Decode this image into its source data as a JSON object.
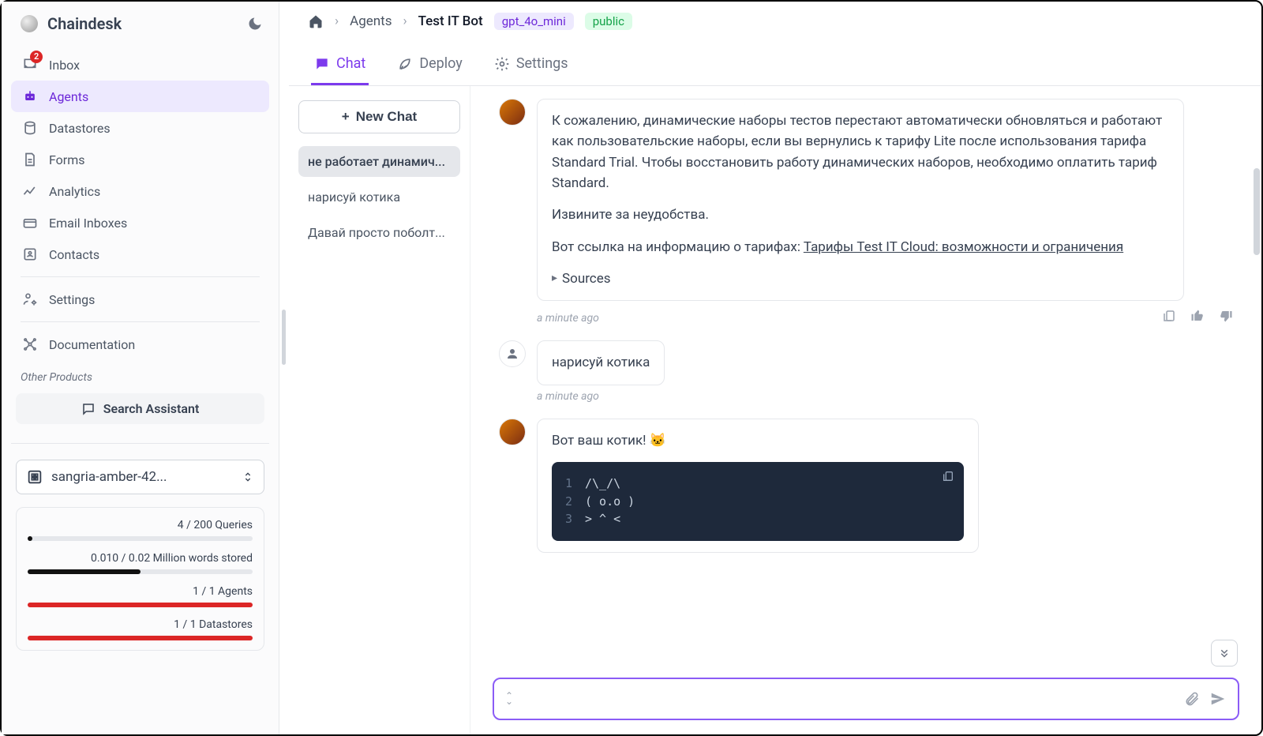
{
  "brand": {
    "name": "Chaindesk"
  },
  "sidebar": {
    "items": [
      {
        "label": "Inbox",
        "badge": "2"
      },
      {
        "label": "Agents"
      },
      {
        "label": "Datastores"
      },
      {
        "label": "Forms"
      },
      {
        "label": "Analytics"
      },
      {
        "label": "Email Inboxes"
      },
      {
        "label": "Contacts"
      }
    ],
    "settings_label": "Settings",
    "docs_label": "Documentation",
    "other_label": "Other Products",
    "search_assistant_label": "Search Assistant",
    "org_name": "sangria-amber-42..."
  },
  "usage": {
    "queries": "4 / 200 Queries",
    "words": "0.010 / 0.02 Million words stored",
    "agents": "1 / 1 Agents",
    "datastores": "1 / 1 Datastores"
  },
  "breadcrumb": {
    "agents": "Agents",
    "bot": "Test IT Bot",
    "model": "gpt_4o_mini",
    "status": "public"
  },
  "tabs": {
    "chat": "Chat",
    "deploy": "Deploy",
    "settings": "Settings"
  },
  "chatlist": {
    "new_chat": "New Chat",
    "items": [
      "не работает динамич...",
      "нарисуй котика",
      "Давай просто поболт..."
    ]
  },
  "messages": {
    "m1": {
      "p1": "К сожалению, динамические наборы тестов перестают автоматически обновляться и работают как пользовательские наборы, если вы вернулись к тарифу Lite после использования тарифа Standard Trial. Чтобы восстановить работу динамических наборов, необходимо оплатить тариф Standard.",
      "p2": "Извините за неудобства.",
      "p3_prefix": "Вот ссылка на информацию о тарифах: ",
      "p3_link": "Тарифы Test IT Cloud: возможности и ограничения",
      "sources": "Sources",
      "time": "a minute ago"
    },
    "m2": {
      "text": "нарисуй котика",
      "time": "a minute ago"
    },
    "m3": {
      "text": "Вот ваш котик! 🐱",
      "code": {
        "l1": " /\\_/\\",
        "l2": "( o.o )",
        "l3": " > ^ <"
      }
    }
  },
  "composer": {
    "placeholder": ""
  }
}
